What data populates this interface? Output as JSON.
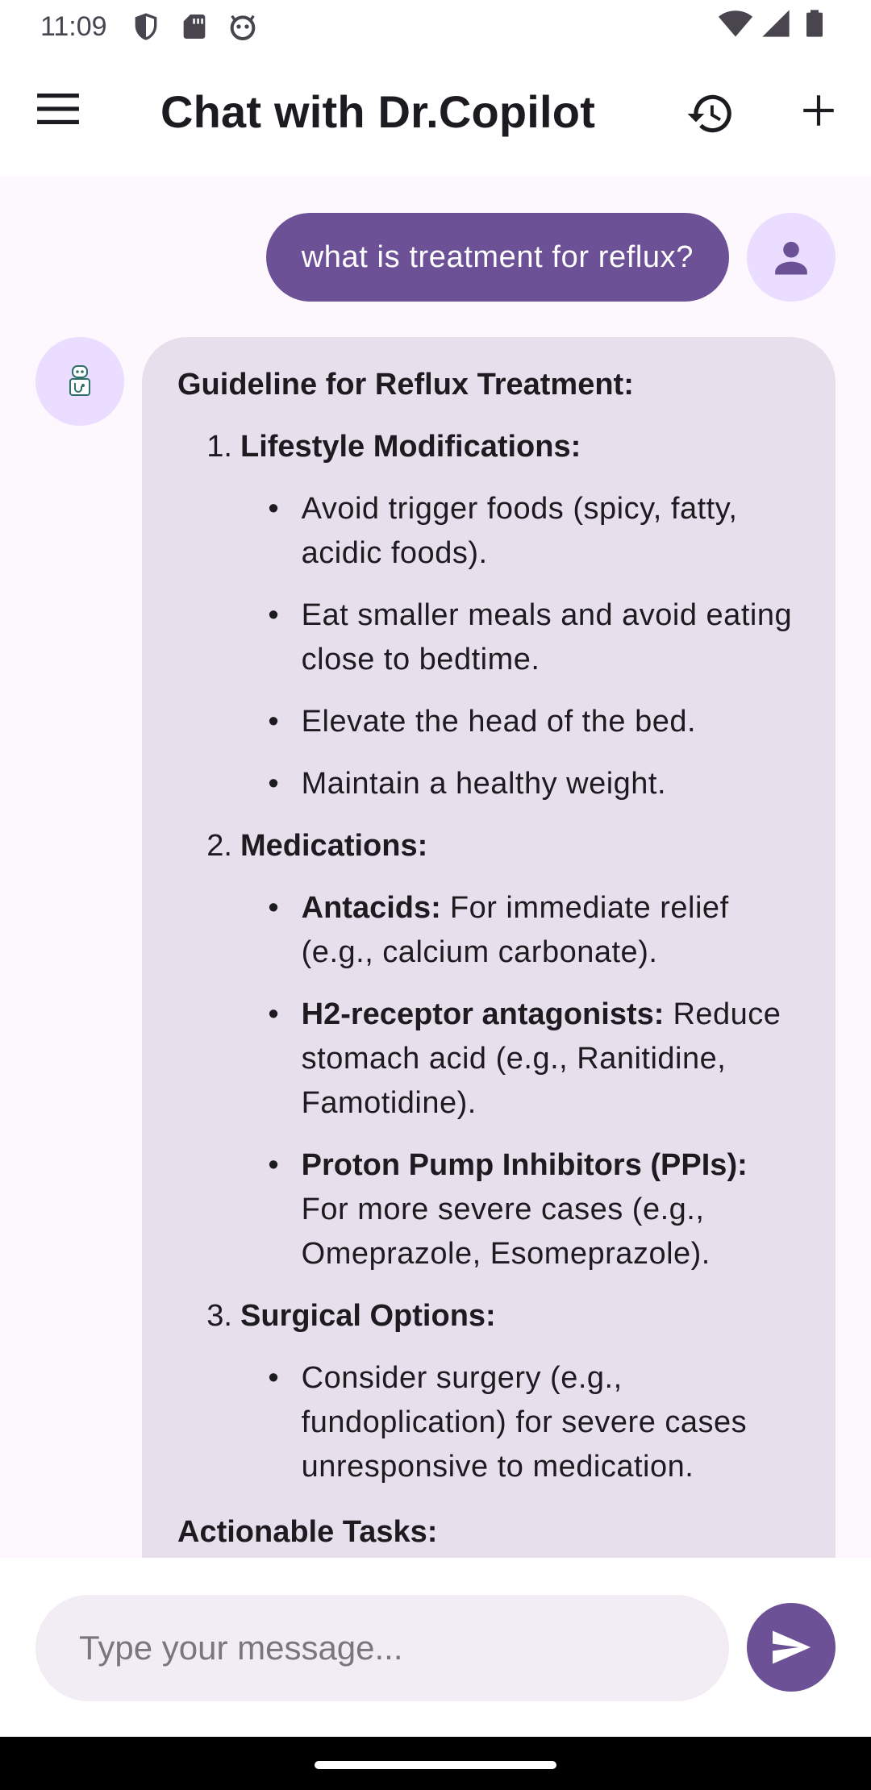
{
  "status_bar": {
    "time": "11:09",
    "icons": [
      "shield-icon",
      "sd-card-icon",
      "bug-face-icon",
      "wifi-icon",
      "cell-signal-icon",
      "battery-icon"
    ]
  },
  "app_bar": {
    "title": "Chat with Dr.Copilot",
    "icons": [
      "menu-icon",
      "history-icon",
      "plus-icon"
    ]
  },
  "conversation": {
    "user_message": "what is treatment for reflux?",
    "bot_message": {
      "heading": "Guideline for Reflux Treatment:",
      "sections": [
        {
          "number": "1.",
          "title": "Lifestyle Modifications:",
          "bullets": [
            {
              "bold": "",
              "text": "Avoid trigger foods (spicy, fatty, acidic foods)."
            },
            {
              "bold": "",
              "text": "Eat smaller meals and avoid eating close to bedtime."
            },
            {
              "bold": "",
              "text": "Elevate the head of the bed."
            },
            {
              "bold": "",
              "text": "Maintain a healthy weight."
            }
          ]
        },
        {
          "number": "2.",
          "title": "Medications:",
          "bullets": [
            {
              "bold": "Antacids:",
              "text": " For immediate relief (e.g., calcium carbonate)."
            },
            {
              "bold": "H2-receptor antagonists:",
              "text": " Reduce stomach acid (e.g., Ranitidine, Famotidine)."
            },
            {
              "bold": "Proton Pump Inhibitors (PPIs):",
              "text": " For more severe cases (e.g., Omeprazole, Esomeprazole)."
            }
          ]
        },
        {
          "number": "3.",
          "title": "Surgical Options:",
          "bullets": [
            {
              "bold": "",
              "text": "Consider surgery (e.g., fundoplication) for severe cases unresponsive to medication."
            }
          ]
        }
      ],
      "trailing_heading": "Actionable Tasks:"
    }
  },
  "composer": {
    "placeholder": "Type your message...",
    "value": ""
  },
  "colors": {
    "accent": "#6c5196",
    "chat_background": "#fdf7fe",
    "bot_bubble": "#e7e0ec",
    "avatar_background": "#eaddff"
  }
}
